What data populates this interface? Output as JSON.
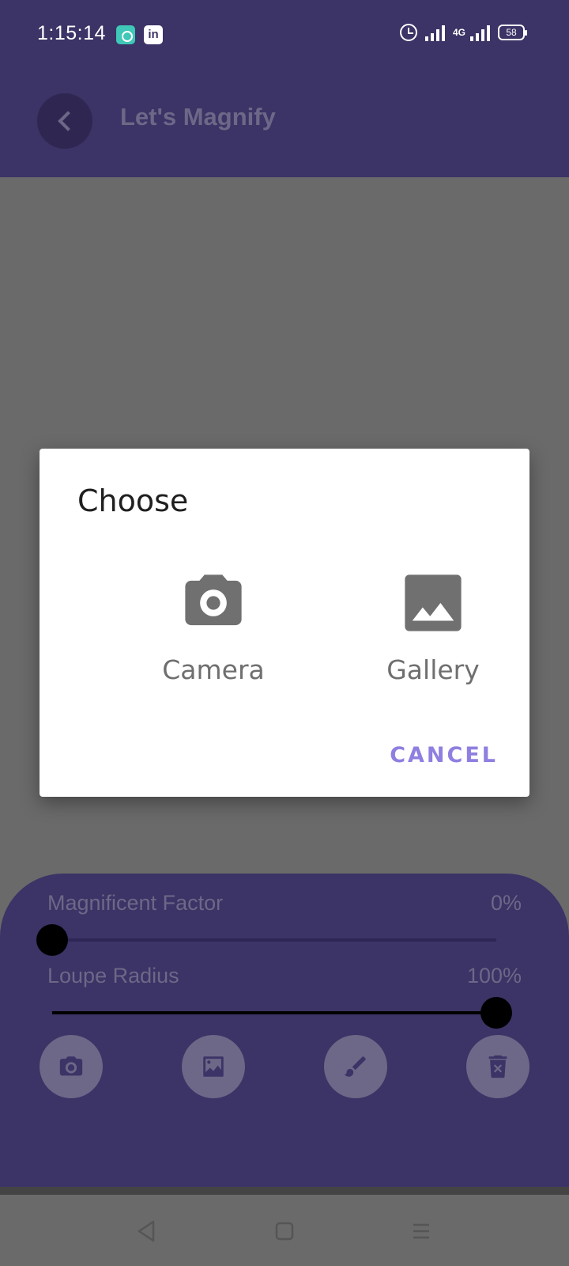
{
  "status_bar": {
    "time": "1:15:14",
    "battery": "58",
    "network": "4G",
    "icons": [
      "app-notification-icon",
      "linkedin-icon",
      "alarm-icon",
      "signal-icon",
      "signal-4g-icon",
      "battery-icon"
    ]
  },
  "app_bar": {
    "title": "Let's Magnify",
    "back_icon": "chevron-left-icon"
  },
  "controls": {
    "magnification": {
      "label": "Magnificent Factor",
      "value_text": "0%",
      "fraction": 0.0
    },
    "loupe_radius": {
      "label": "Loupe Radius",
      "value_text": "100%",
      "fraction": 1.0
    },
    "buttons": [
      "camera-icon",
      "gallery-icon",
      "brush-icon",
      "delete-icon"
    ]
  },
  "dialog": {
    "title": "Choose",
    "options": [
      {
        "label": "Camera",
        "icon": "camera-icon"
      },
      {
        "label": "Gallery",
        "icon": "image-icon"
      }
    ],
    "cancel_label": "CANCEL"
  },
  "nav_bar": {
    "keys": [
      "back-nav-icon",
      "home-nav-icon",
      "menu-nav-icon"
    ]
  },
  "colors": {
    "primary": "#3c3366",
    "scrim": "#6a6a6a",
    "accent": "#8e7fe0",
    "dialog_bg": "#ffffff"
  }
}
